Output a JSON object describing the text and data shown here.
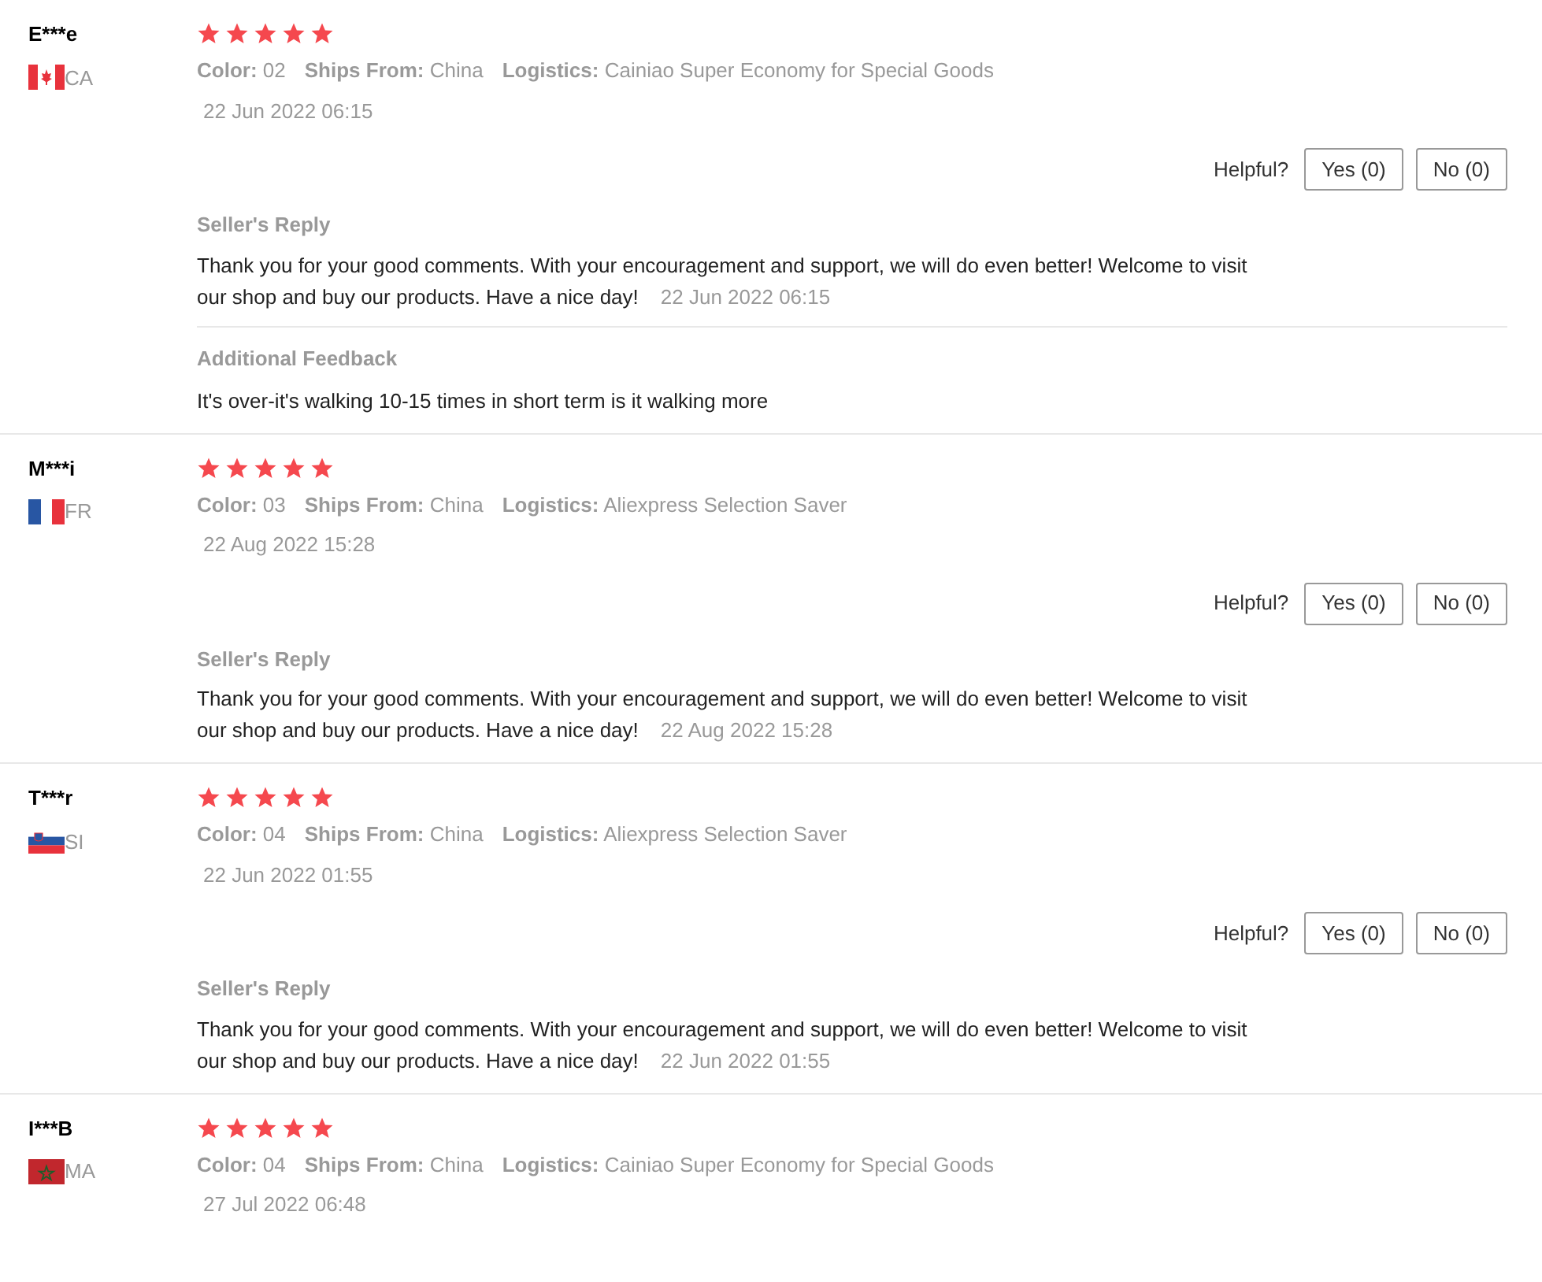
{
  "reviews": [
    {
      "name": "E***e",
      "kind": "canada",
      "country": "CA",
      "stars": 5,
      "color_label": "Color:",
      "color_value": "02",
      "ships_label": "Ships From:",
      "ships": "China",
      "logistics_label": "Logistics:",
      "logistics": "Cainiao Super Economy for Special Goods",
      "date": "22 Jun 2022 06:15",
      "helpful": "Helpful?",
      "yes": "Yes (0)",
      "no": "No (0)",
      "reply_title": "Seller's Reply",
      "reply": "Thank you for your good comments. With your encouragement and support, we will do even better! Welcome to visit our shop and buy our products. Have a nice day!",
      "reply_date": "22 Jun 2022 06:15",
      "feedback_title": "Additional Feedback",
      "feedback": "It's over-it's walking 10-15 times in short term is it walking more"
    },
    {
      "name": "M***i",
      "kind": "france",
      "country": "FR",
      "stars": 5,
      "color_label": "Color:",
      "color_value": "03",
      "ships_label": "Ships From:",
      "ships": "China",
      "logistics_label": "Logistics:",
      "logistics": "Aliexpress Selection Saver",
      "date": "22 Aug 2022 15:28",
      "helpful": "Helpful?",
      "yes": "Yes (0)",
      "no": "No (0)",
      "reply_title": "Seller's Reply",
      "reply": "Thank you for your good comments. With your encouragement and support, we will do even better! Welcome to visit our shop and buy our products. Have a nice day!",
      "reply_date": "22 Aug 2022 15:28"
    },
    {
      "name": "T***r",
      "kind": "slovenia",
      "country": "SI",
      "stars": 5,
      "color_label": "Color:",
      "color_value": "04",
      "ships_label": "Ships From:",
      "ships": "China",
      "logistics_label": "Logistics:",
      "logistics": "Aliexpress Selection Saver",
      "date": "22 Jun 2022 01:55",
      "helpful": "Helpful?",
      "yes": "Yes (0)",
      "no": "No (0)",
      "reply_title": "Seller's Reply",
      "reply": "Thank you for your good comments. With your encouragement and support, we will do even better! Welcome to visit our shop and buy our products. Have a nice day!",
      "reply_date": "22 Jun 2022 01:55"
    },
    {
      "name": "I***B",
      "kind": "morocco",
      "country": "MA",
      "stars": 5,
      "color_label": "Color:",
      "color_value": "04",
      "ships_label": "Ships From:",
      "ships": "China",
      "logistics_label": "Logistics:",
      "logistics": "Cainiao Super Economy for Special Goods",
      "date": "27 Jul 2022 06:48"
    }
  ]
}
